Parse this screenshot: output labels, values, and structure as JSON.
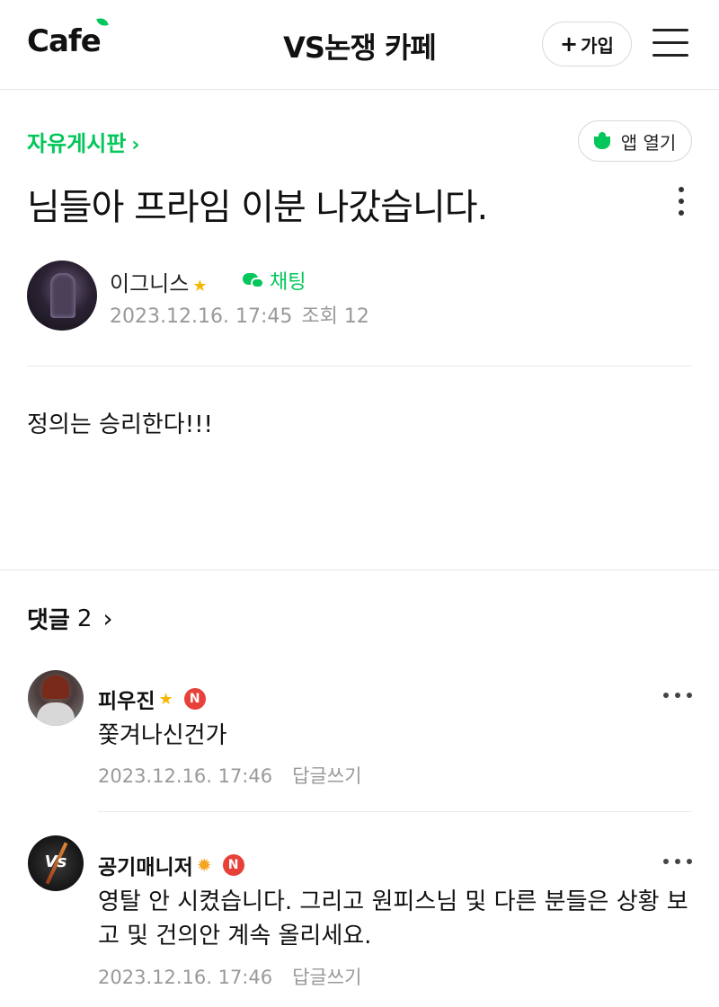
{
  "header": {
    "logo": "Cafe",
    "cafe_name": "VS논쟁 카페",
    "join_label": "가입",
    "join_icon": "plus-icon",
    "menu_icon": "hamburger-menu-icon"
  },
  "post": {
    "board": "자유게시판",
    "app_open_label": "앱 열기",
    "title": "님들아 프라임 이분 나갔습니다.",
    "author": "이그니스",
    "chat_label": "채팅",
    "date": "2023.12.16. 17:45",
    "views": "조회 12",
    "body": "정의는 승리한다!!!"
  },
  "comments_section": {
    "label": "댓글",
    "count": "2"
  },
  "comments": [
    {
      "author": "피우진",
      "text": "쫓겨나신건가",
      "date": "2023.12.16. 17:46",
      "reply_label": "답글쓰기"
    },
    {
      "author": "공기매니저",
      "avatar_text": "Vs",
      "text": "영탈 안 시켰습니다. 그리고 원피스님 및 다른 분들은 상황 보고 및 건의안 계속 올리세요.",
      "date": "2023.12.16. 17:46",
      "reply_label": "답글쓰기"
    }
  ],
  "badge_text": "N",
  "colors": {
    "accent_green": "#03c75a",
    "badge_red": "#e8413a",
    "meta_gray": "#999999",
    "star_yellow": "#f5b800"
  }
}
